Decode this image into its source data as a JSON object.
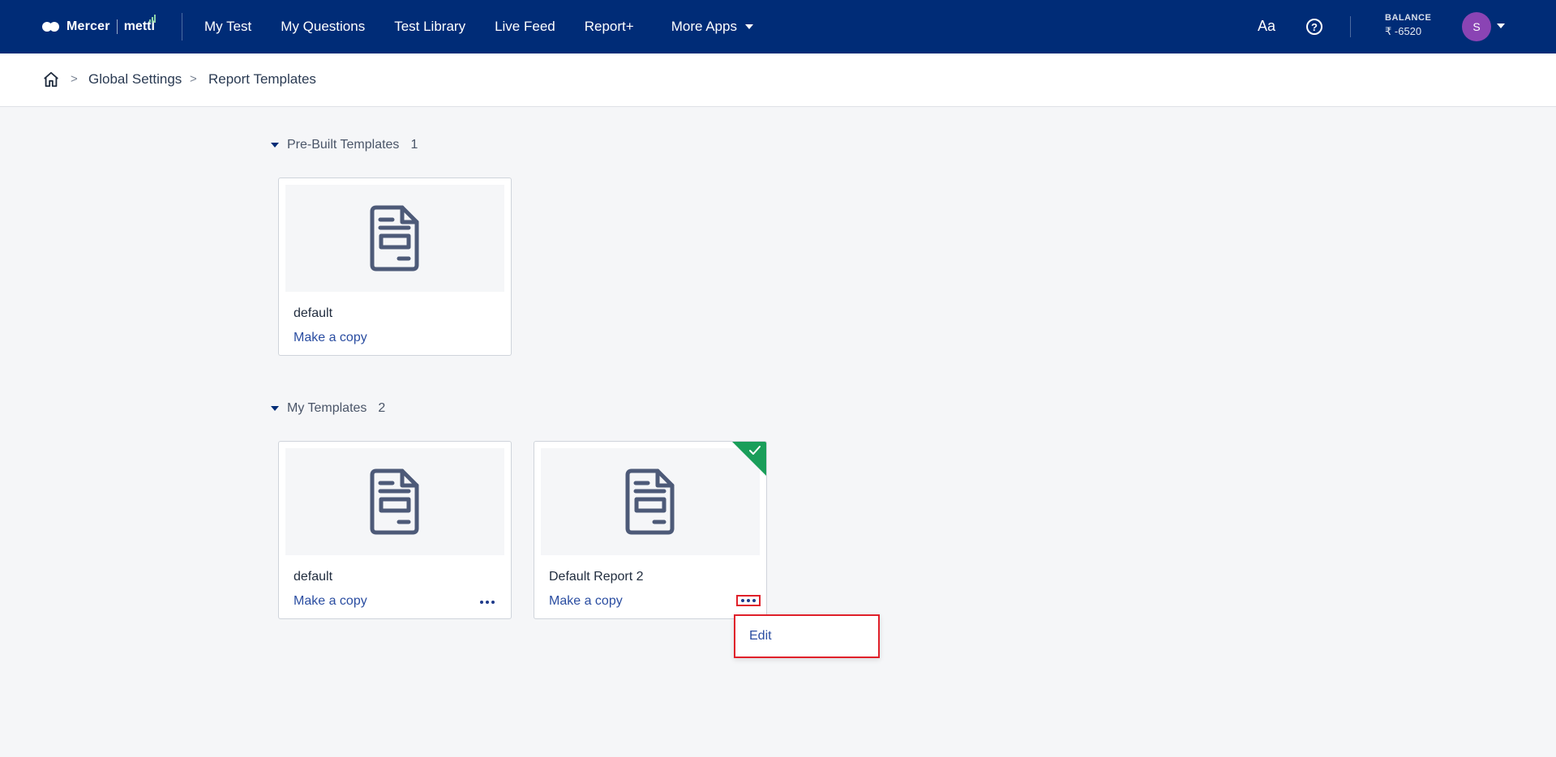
{
  "brand": {
    "name": "Mercer",
    "product": "mettl"
  },
  "nav": {
    "items": [
      "My Test",
      "My Questions",
      "Test Library",
      "Live Feed",
      "Report+"
    ],
    "more_label": "More Apps"
  },
  "toolbar": {
    "font_toggle": "Aa",
    "help": "?",
    "balance_label": "BALANCE",
    "balance_value": "₹ -6520",
    "avatar_initial": "S"
  },
  "breadcrumb": {
    "items": [
      "Global Settings",
      "Report Templates"
    ],
    "separator": ">"
  },
  "sections": {
    "prebuilt": {
      "title": "Pre-Built Templates",
      "count": "1",
      "cards": [
        {
          "name": "default",
          "action": "Make a copy"
        }
      ]
    },
    "mine": {
      "title": "My Templates",
      "count": "2",
      "cards": [
        {
          "name": "default",
          "action": "Make a copy"
        },
        {
          "name": "Default Report 2",
          "action": "Make a copy"
        }
      ]
    }
  },
  "menu": {
    "items": [
      "Edit"
    ]
  },
  "colors": {
    "nav_bg": "#002c77",
    "link": "#2a4da1",
    "selected_badge": "#1a9e5a",
    "highlight": "#e0202a",
    "avatar": "#8a44b4"
  }
}
